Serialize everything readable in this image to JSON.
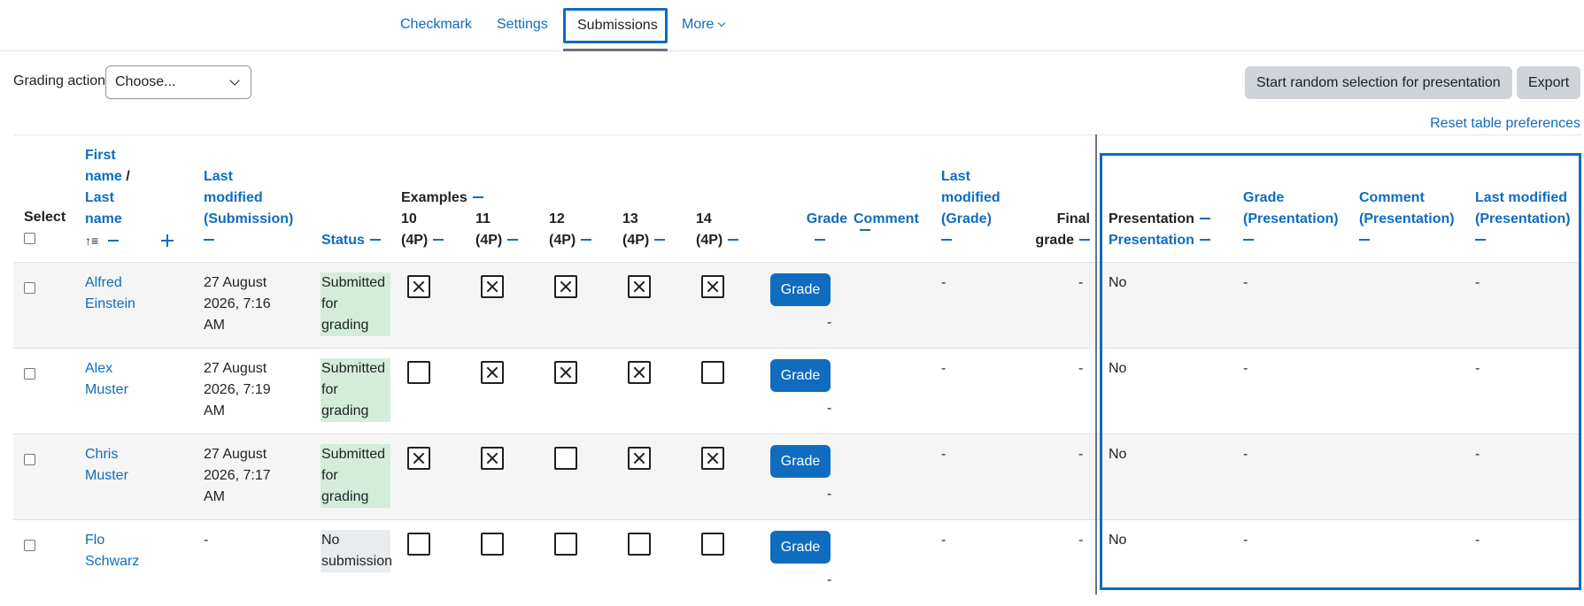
{
  "tabs": [
    {
      "label": "Checkmark"
    },
    {
      "label": "Settings"
    },
    {
      "label": "Submissions"
    },
    {
      "label": "More"
    }
  ],
  "actions": {
    "grading_label": "Grading action",
    "grading_select": "Choose...",
    "random_button": "Start random selection for presentation",
    "export_button": "Export",
    "reset_link": "Reset table preferences"
  },
  "headers": {
    "select": "Select",
    "first": "First",
    "name1": "name",
    "slash": " /",
    "last": "Last",
    "name2": "name",
    "last_modified_sub": [
      "Last",
      "modified",
      "(Submission)"
    ],
    "status": "Status",
    "examples": "Examples",
    "ex": [
      {
        "num": "10",
        "pts": "(4P)"
      },
      {
        "num": "11",
        "pts": "(4P)"
      },
      {
        "num": "12",
        "pts": "(4P)"
      },
      {
        "num": "13",
        "pts": "(4P)"
      },
      {
        "num": "14",
        "pts": "(4P)"
      }
    ],
    "grade": "Grade",
    "comment": "Comment",
    "last_modified_grade": [
      "Last",
      "modified",
      "(Grade)"
    ],
    "final1": "Final",
    "final2": "grade",
    "presentation": "Presentation",
    "presentation_sub": "Presentation",
    "grade_pres": [
      "Grade",
      "(Presentation)"
    ],
    "comment_pres": [
      "Comment",
      "(Presentation)"
    ],
    "lastmod_pres": [
      "Last modified",
      "(Presentation)"
    ]
  },
  "rows": [
    {
      "first": "Alfred",
      "last": "Einstein",
      "modified": [
        "27 August",
        "2026, 7:16",
        "AM"
      ],
      "status": [
        "Submitted",
        "for",
        "grading"
      ],
      "status_type": "sub",
      "examples": [
        true,
        true,
        true,
        true,
        true
      ],
      "grade_button": "Grade",
      "grade_value": "-",
      "lastmod_grade": "-",
      "final_grade": "-",
      "presentation": "No",
      "grade_pres": "-",
      "lastmod_pres": "-"
    },
    {
      "first": "Alex",
      "last": "Muster",
      "modified": [
        "27 August",
        "2026, 7:19",
        "AM"
      ],
      "status": [
        "Submitted",
        "for",
        "grading"
      ],
      "status_type": "sub",
      "examples": [
        false,
        true,
        true,
        true,
        false
      ],
      "grade_button": "Grade",
      "grade_value": "-",
      "lastmod_grade": "-",
      "final_grade": "-",
      "presentation": "No",
      "grade_pres": "-",
      "lastmod_pres": "-"
    },
    {
      "first": "Chris",
      "last": "Muster",
      "modified": [
        "27 August",
        "2026, 7:17",
        "AM"
      ],
      "status": [
        "Submitted",
        "for",
        "grading"
      ],
      "status_type": "sub",
      "examples": [
        true,
        true,
        false,
        true,
        true
      ],
      "grade_button": "Grade",
      "grade_value": "-",
      "lastmod_grade": "-",
      "final_grade": "-",
      "presentation": "No",
      "grade_pres": "-",
      "lastmod_pres": "-"
    },
    {
      "first": "Flo",
      "last": "Schwarz",
      "modified": [
        "-"
      ],
      "status": [
        "No",
        "submission"
      ],
      "status_type": "none",
      "examples": [
        false,
        false,
        false,
        false,
        false
      ],
      "grade_button": "Grade",
      "grade_value": "-",
      "lastmod_grade": "-",
      "final_grade": "-",
      "presentation": "No",
      "grade_pres": "-",
      "lastmod_pres": "-"
    }
  ],
  "colors": {
    "accent": "#0f6cbf",
    "submitted_bg": "#d4edda",
    "none_bg": "#e9ecef"
  }
}
